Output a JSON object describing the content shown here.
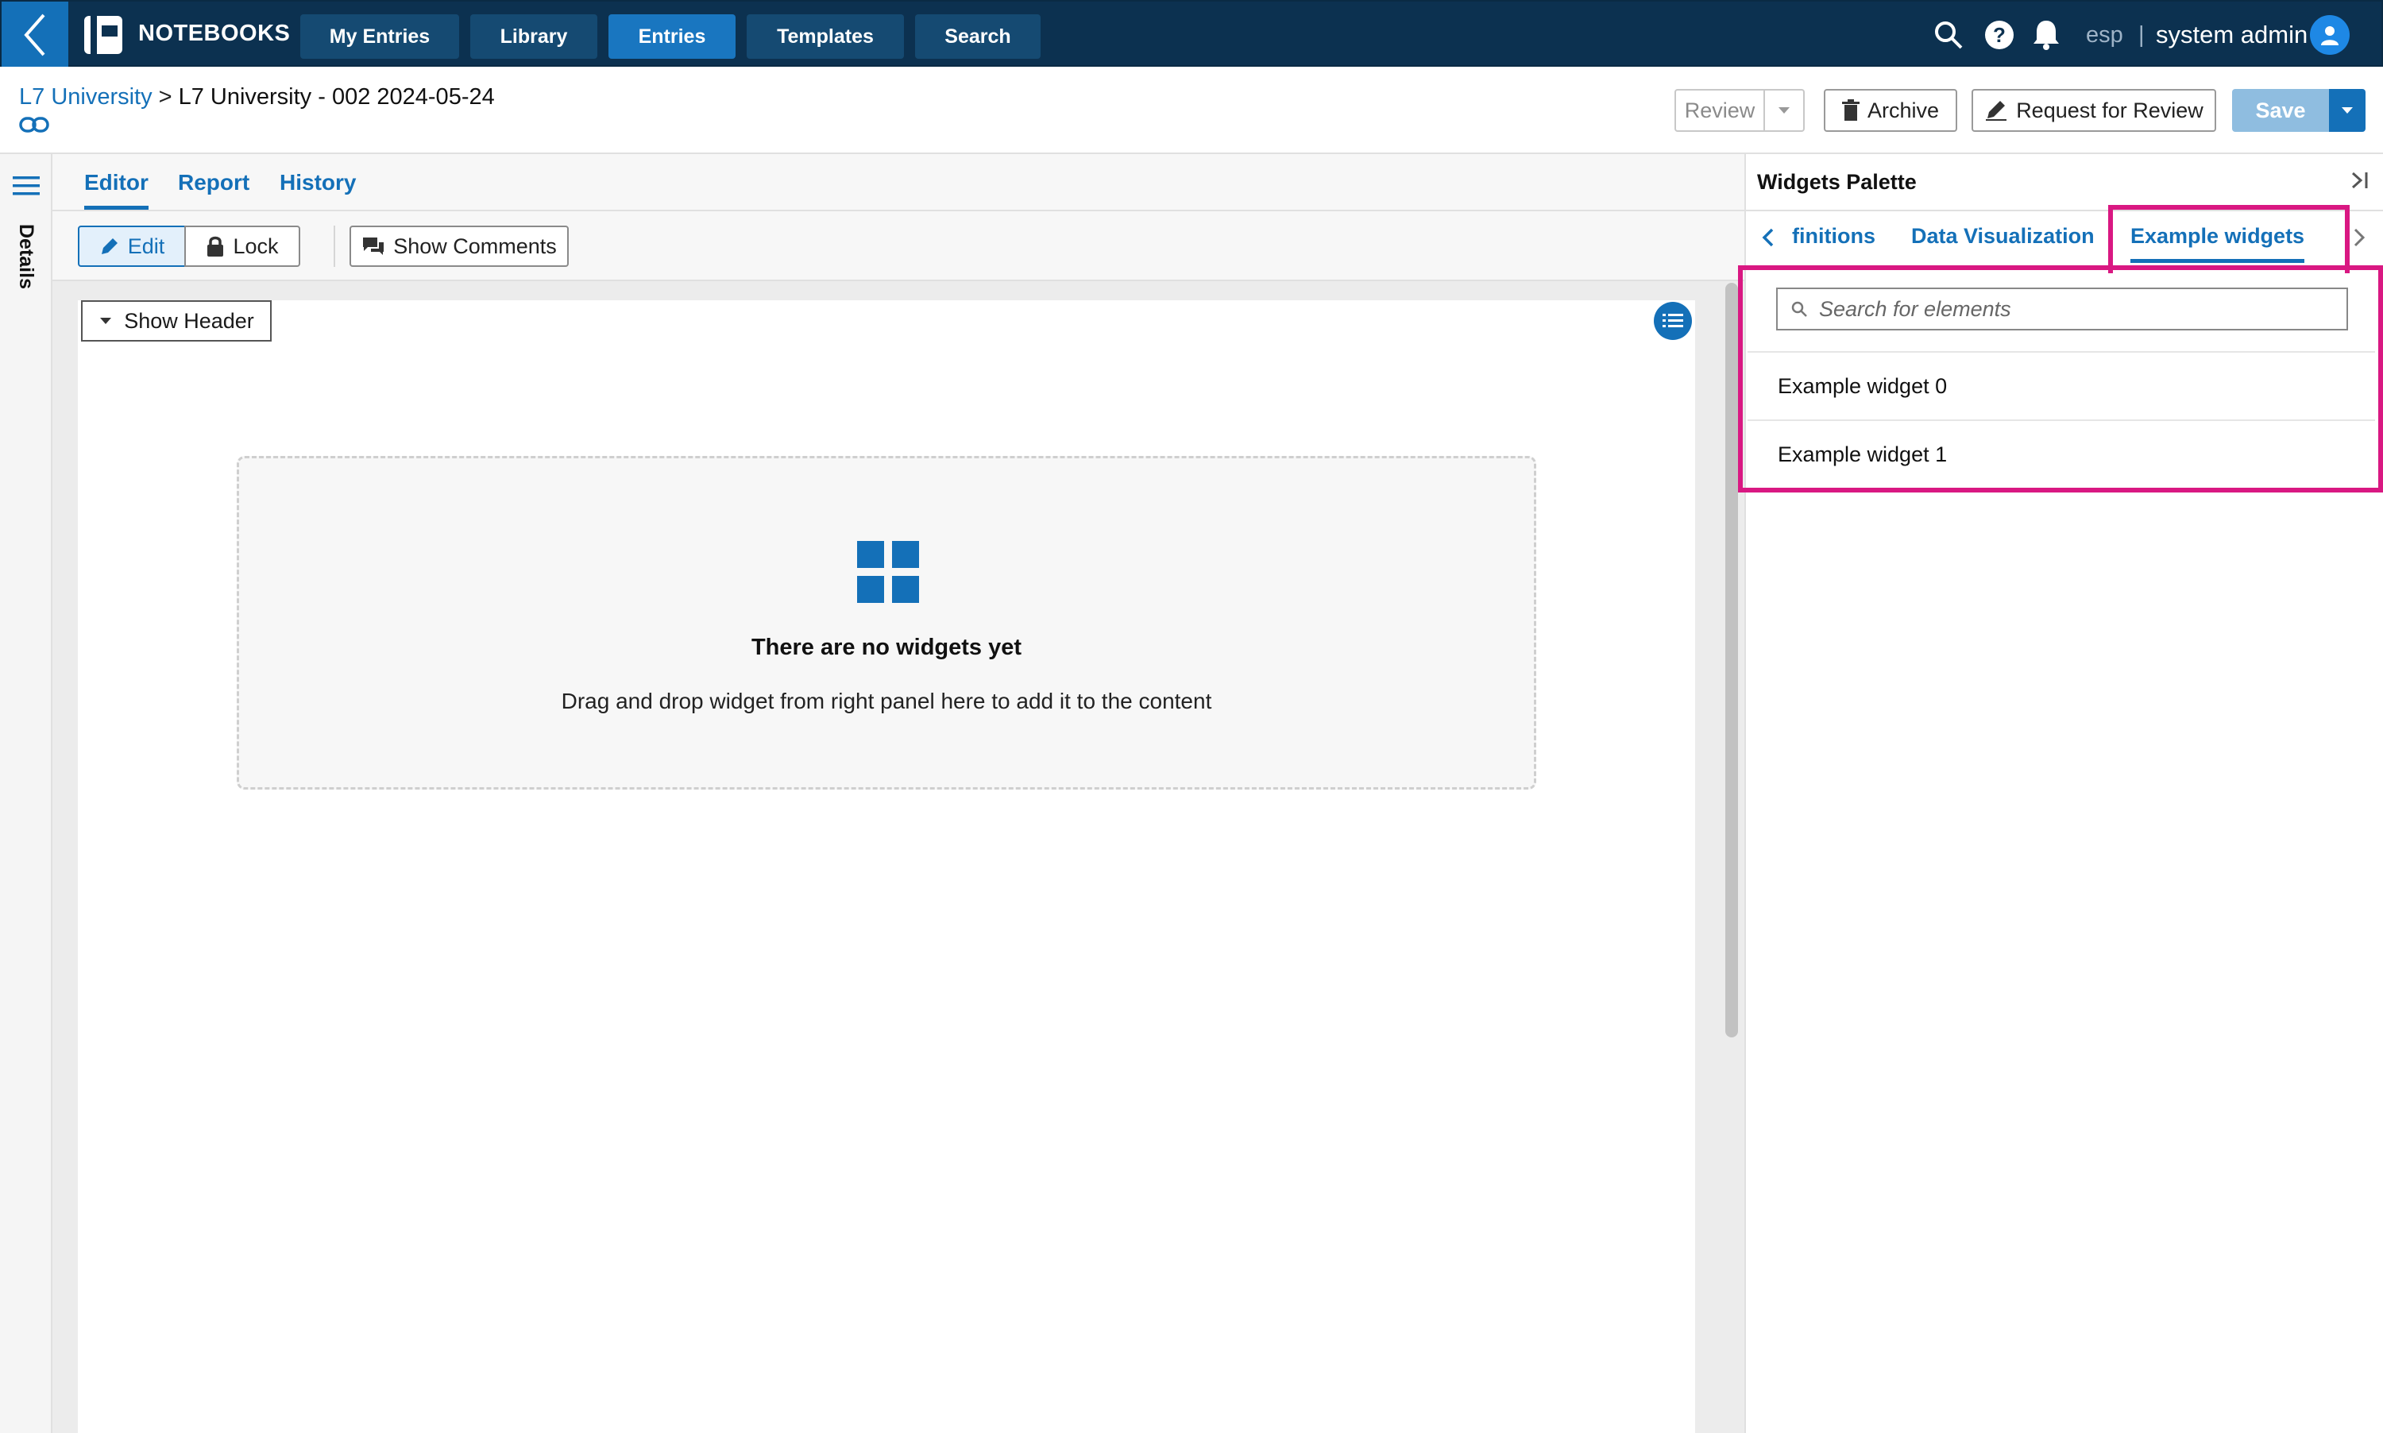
{
  "app": {
    "title": "NOTEBOOKS"
  },
  "nav": {
    "tabs": [
      {
        "label": "My Entries"
      },
      {
        "label": "Library"
      },
      {
        "label": "Entries"
      },
      {
        "label": "Templates"
      },
      {
        "label": "Search"
      }
    ]
  },
  "user": {
    "language": "esp",
    "separator": "|",
    "name": "system admin"
  },
  "breadcrumb": {
    "root": "L7 University",
    "separator": ">",
    "current": "L7 University - 002 2024-05-24"
  },
  "actions": {
    "review": "Review",
    "archive": "Archive",
    "request_review": "Request for Review",
    "save": "Save"
  },
  "sidebar": {
    "details_label": "Details"
  },
  "editor": {
    "tabs": [
      {
        "label": "Editor"
      },
      {
        "label": "Report"
      },
      {
        "label": "History"
      }
    ],
    "toolbar": {
      "edit": "Edit",
      "lock": "Lock",
      "show_comments": "Show Comments"
    },
    "show_header": "Show Header",
    "empty": {
      "title": "There are no widgets yet",
      "description": "Drag and drop widget from right panel here to add it to the content"
    }
  },
  "palette": {
    "title": "Widgets Palette",
    "tabs": [
      {
        "label": "finitions"
      },
      {
        "label": "Data Visualization"
      },
      {
        "label": "Example widgets"
      }
    ],
    "search_placeholder": "Search for elements",
    "items": [
      {
        "label": "Example widget 0"
      },
      {
        "label": "Example widget 1"
      }
    ]
  },
  "colors": {
    "brand": "#0c3150",
    "accent": "#1470b8",
    "highlight": "#d91882"
  }
}
